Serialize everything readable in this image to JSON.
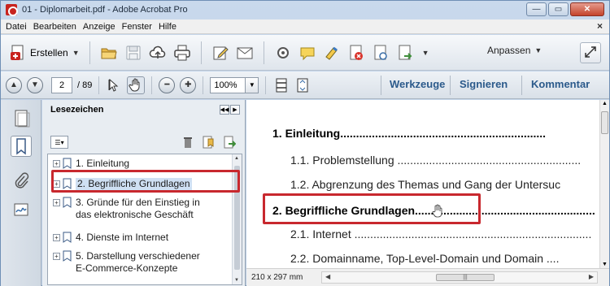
{
  "window": {
    "title": "01 - Diplomarbeit.pdf - Adobe Acrobat Pro",
    "controls": {
      "minimize": "—",
      "maximize": "▭",
      "close": "✕"
    }
  },
  "menu": {
    "items": [
      "Datei",
      "Bearbeiten",
      "Anzeige",
      "Fenster",
      "Hilfe"
    ],
    "close_glyph": "×"
  },
  "toolbar": {
    "create_label": "Erstellen",
    "customize_label": "Anpassen",
    "icons": [
      "open-folder-icon",
      "save-icon",
      "cloud-upload-icon",
      "print-icon",
      "edit-document-icon",
      "email-icon",
      "settings-icon",
      "comment-icon",
      "highlight-icon",
      "pdf-export-icon",
      "pdf-share-icon",
      "pdf-combine-icon",
      "expand-icon"
    ]
  },
  "navigation": {
    "current_page": "2",
    "total_pages": "/ 89",
    "zoom": "100%",
    "tabs": {
      "tools": "Werkzeuge",
      "sign": "Signieren",
      "comment": "Kommentar"
    }
  },
  "bookmarks": {
    "title": "Lesezeichen",
    "items": [
      {
        "lines": [
          "1. Einleitung"
        ]
      },
      {
        "lines": [
          "2. Begriffliche Grundlagen"
        ]
      },
      {
        "lines": [
          "3. Gründe für den Einstieg in",
          "das elektronische Geschäft"
        ]
      },
      {
        "lines": [
          "4. Dienste im Internet"
        ]
      },
      {
        "lines": [
          "5. Darstellung verschiedener",
          "E-Commerce-Konzepte"
        ]
      }
    ],
    "selected_index": 1
  },
  "document": {
    "toc": [
      {
        "text": "1. Einleitung.................................................................",
        "level": 1
      },
      {
        "text": "1.1. Problemstellung ..........................................................",
        "level": 2
      },
      {
        "text": "1.2. Abgrenzung des Themas und Gang der Untersuc",
        "level": 2
      },
      {
        "text": "2. Begriffliche Grundlagen.........................................................",
        "level": 1
      },
      {
        "text": "2.1. Internet ...........................................................................",
        "level": 2
      },
      {
        "text": "2.2. Domainname, Top-Level-Domain und Domain ....",
        "level": 2
      }
    ],
    "page_size": "210 x 297 mm"
  },
  "colors": {
    "highlight": "#c8282e",
    "tab_text": "#2b5a8b"
  }
}
